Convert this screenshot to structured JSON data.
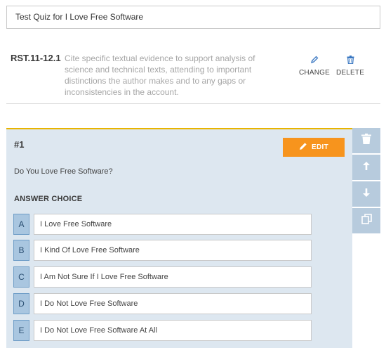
{
  "quiz": {
    "title": "Test Quiz for I Love Free Software"
  },
  "standard": {
    "code": "RST.11-12.1",
    "description": "Cite specific textual evidence to support analysis of science and technical texts, attending to important distinctions the author makes and to any gaps or inconsistencies in the account.",
    "change_label": "CHANGE",
    "delete_label": "DELETE"
  },
  "question": {
    "number": "#1",
    "edit_label": "EDIT",
    "text": "Do You Love Free Software?",
    "answers_heading": "ANSWER CHOICE",
    "choices": [
      {
        "letter": "A",
        "text": "I Love Free Software"
      },
      {
        "letter": "B",
        "text": "I Kind Of Love Free Software"
      },
      {
        "letter": "C",
        "text": "I Am Not Sure If I Love Free Software"
      },
      {
        "letter": "D",
        "text": "I Do Not Love Free Software"
      },
      {
        "letter": "E",
        "text": "I Do Not Love Free Software At All"
      }
    ]
  },
  "tools": [
    "trash-icon",
    "arrow-up-icon",
    "arrow-down-icon",
    "duplicate-icon"
  ],
  "colors": {
    "accent_orange": "#f7941d",
    "accent_yellow": "#e8b400",
    "card_bg": "#dde7f0",
    "link_blue": "#3b78c2"
  }
}
